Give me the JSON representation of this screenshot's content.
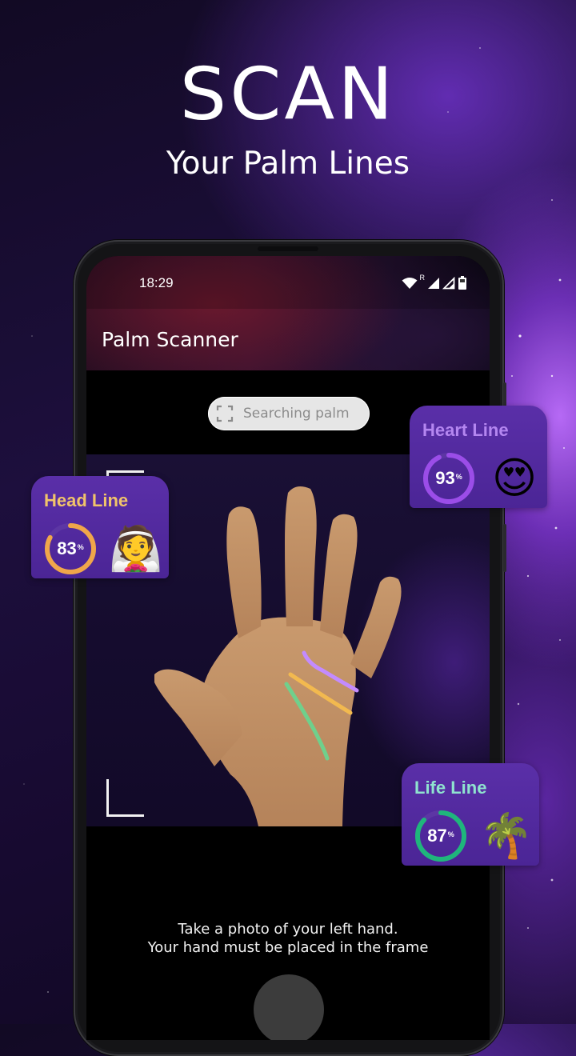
{
  "promo": {
    "headline": "SCAN",
    "subheadline": "Your Palm Lines"
  },
  "status_bar": {
    "time": "18:29",
    "icons": [
      "wifi-icon",
      "roaming-indicator",
      "signal-full-icon",
      "signal-outline-icon",
      "battery-icon"
    ],
    "roaming_label": "R"
  },
  "app": {
    "title": "Palm Scanner",
    "scan_status": "Searching palm",
    "scan_status_icon": "scan-frame-icon",
    "instructions_line1": "Take a photo of your left hand.",
    "instructions_line2": "Your hand must be placed in the frame",
    "shutter_icon": "shutter-button"
  },
  "palm_lines_overlay": [
    {
      "name": "heart",
      "color": "#c38bff"
    },
    {
      "name": "head",
      "color": "#f2b94f"
    },
    {
      "name": "life",
      "color": "#6fd08c"
    }
  ],
  "cards": {
    "heart": {
      "title": "Heart Line",
      "percent": 93,
      "percent_label": "93",
      "unit": "%",
      "emoji": "😍",
      "emoji_name": "heart-eyes-emoji",
      "title_color": "#b486f0",
      "ring_color": "#9b4de8"
    },
    "head": {
      "title": "Head Line",
      "percent": 83,
      "percent_label": "83",
      "unit": "%",
      "emoji": "👰",
      "emoji_name": "bride-emoji",
      "title_color": "#f1c46a",
      "ring_color": "#f0a64a"
    },
    "life": {
      "title": "Life Line",
      "percent": 87,
      "percent_label": "87",
      "unit": "%",
      "emoji": "🌴",
      "emoji_name": "palm-tree-emoji",
      "title_color": "#8fe3cf",
      "ring_color": "#1fb67c"
    }
  }
}
